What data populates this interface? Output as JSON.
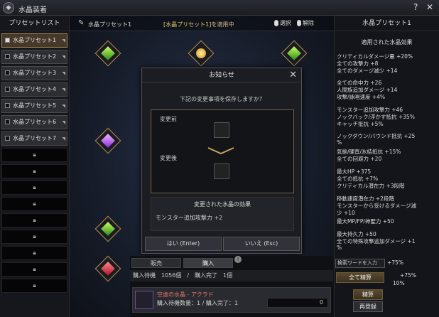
{
  "window": {
    "title": "水晶装着",
    "help": "?",
    "close": "✕",
    "logo_icon": "crystal-logo-icon"
  },
  "left": {
    "header": "プリセットリスト",
    "presets": [
      {
        "label": "水晶プリセット1",
        "active": true
      },
      {
        "label": "水晶プリセット2",
        "active": false
      },
      {
        "label": "水晶プリセット3",
        "active": false
      },
      {
        "label": "水晶プリセット4",
        "active": false
      },
      {
        "label": "水晶プリセット5",
        "active": false
      },
      {
        "label": "水晶プリセット6",
        "active": false
      },
      {
        "label": "水晶プリセット7",
        "active": false
      }
    ],
    "locked_count": 9
  },
  "center": {
    "preset_name": "水晶プリセット1",
    "applied_prefix": "[水晶プリセット1]",
    "applied_suffix": "を適用中",
    "select_label": "選択",
    "release_label": "解除"
  },
  "modal": {
    "title": "お知らせ",
    "question": "下記の変更事項を保存しますか？",
    "before_label": "変更前",
    "after_label": "変更後",
    "effect_title": "変更された水晶の効果",
    "effect_line": "モンスター追加攻撃力 +2",
    "yes_label": "はい (Enter)",
    "no_label": "いいえ (Esc)"
  },
  "shop": {
    "tab_sell": "販売",
    "tab_buy": "購入",
    "badge": "!",
    "wait_text": "購入待機　1056個　/　購入完了　1個",
    "item_name": "空虚の水晶 - アクラド",
    "item_qty": "購入待機数量：1 / 購入完了：1",
    "count": "0"
  },
  "right": {
    "header": "水晶プリセット1",
    "sub": "適用された水晶効果",
    "effects": [
      "クリティカルダメージ量 +20%",
      "全ての攻撃力 +8",
      "全てのダメージ減少 +14",
      "全ての命中力 +26",
      "人間族追加ダメージ +14",
      "攻撃/詠唱速度 +4%",
      "モンスター追加攻撃力 +46",
      "ノックバック/浮かす抵抗 +35%",
      "キャッチ抵抗 +5%",
      "ノックダウン/バウンド抵抗 +25",
      "%",
      "気絶/硬直/氷結抵抗 +15%",
      "全ての回避力 +20",
      "最大HP +375",
      "全ての抵抗 +7%",
      "クリティカル潜在力 +3段階",
      "移動速度潜在力 +2段階",
      "モンスターから受けるダメージ減",
      "少 +10",
      "最大MP/FP/神聖力 +50",
      "最大持久力 +50",
      "全ての特殊攻撃追加ダメージ +1",
      "%"
    ],
    "search_placeholder": "検索ワードを入力",
    "pct1": "+75%",
    "pct2": "+75%",
    "pct3": "10%",
    "btn_settle_all": "全て精算",
    "btn_settle": "精算",
    "btn_reregister": "再登録"
  }
}
